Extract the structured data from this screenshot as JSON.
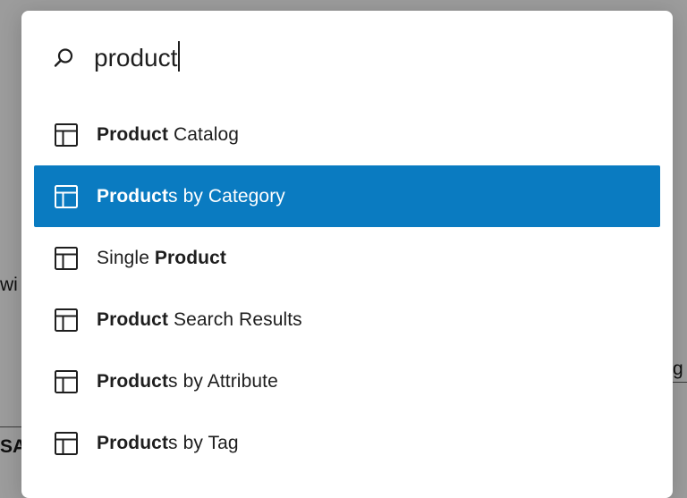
{
  "background": {
    "left_fragment": "wi",
    "right_fragment": "g",
    "bottom_left_fragment": "SA"
  },
  "search": {
    "icon": "search-icon",
    "value": "product"
  },
  "results": [
    {
      "icon": "template-layout-icon",
      "match": "Product",
      "rest": " Catalog",
      "prefix": "",
      "selected": false
    },
    {
      "icon": "template-layout-icon",
      "match": "Product",
      "rest": "s by Category",
      "prefix": "",
      "selected": true
    },
    {
      "icon": "template-layout-icon",
      "match": "Product",
      "rest": "",
      "prefix": "Single ",
      "selected": false
    },
    {
      "icon": "template-layout-icon",
      "match": "Product",
      "rest": " Search Results",
      "prefix": "",
      "selected": false
    },
    {
      "icon": "template-layout-icon",
      "match": "Product",
      "rest": "s by Attribute",
      "prefix": "",
      "selected": false
    },
    {
      "icon": "template-layout-icon",
      "match": "Product",
      "rest": "s by Tag",
      "prefix": "",
      "selected": false
    }
  ],
  "colors": {
    "selected_background": "#0a7bc1",
    "overlay": "#9c9c9c"
  }
}
